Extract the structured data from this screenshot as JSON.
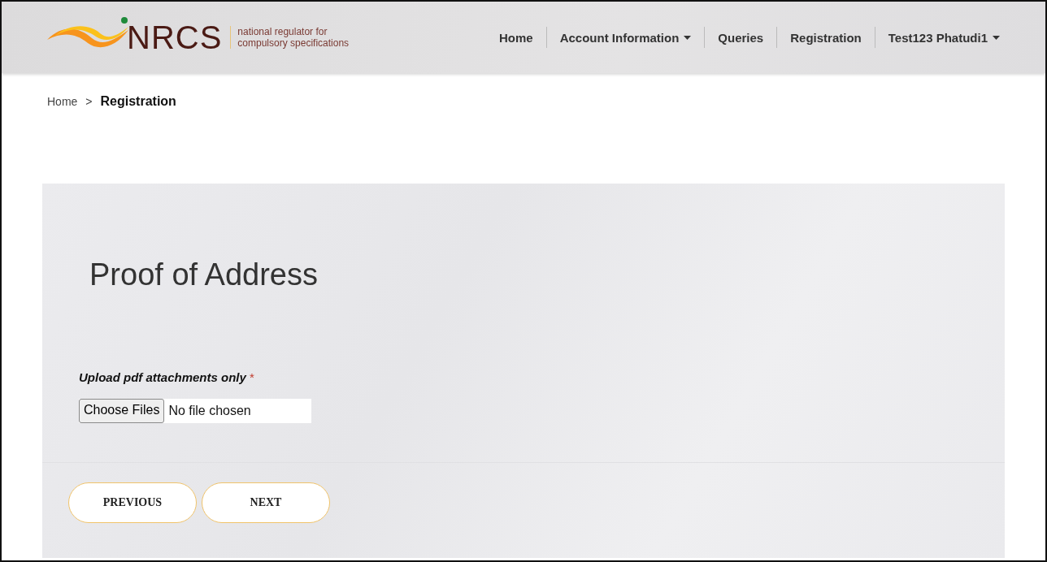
{
  "header": {
    "logo": {
      "wordmark": "NRCS",
      "tagline_lines": [
        "national regulator for",
        "compulsory specifications"
      ]
    },
    "nav": [
      {
        "label": "Home",
        "dropdown": false
      },
      {
        "label": "Account Information",
        "dropdown": true
      },
      {
        "label": "Queries",
        "dropdown": false
      },
      {
        "label": "Registration",
        "dropdown": false
      },
      {
        "label": "Test123 Phatudi1",
        "dropdown": true
      }
    ]
  },
  "breadcrumb": [
    {
      "label": "Home",
      "current": false
    },
    {
      "label": "Registration",
      "current": true
    }
  ],
  "breadcrumb_separator": ">",
  "form": {
    "title": "Proof of Address",
    "field_label": "Upload pdf attachments only",
    "required_mark": "*",
    "file_input": {
      "button": "Choose Files",
      "status": "No file chosen"
    },
    "buttons": [
      "PREVIOUS",
      "NEXT"
    ]
  }
}
